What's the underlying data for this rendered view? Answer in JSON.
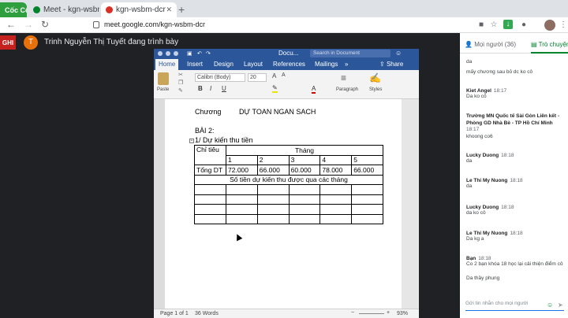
{
  "browser": {
    "tabs": [
      {
        "label": "Cốc Cốc"
      },
      {
        "label": "Meet - kgn-wsbm-dcr"
      },
      {
        "label": "kgn-wsbm-dcr"
      }
    ],
    "new_tab": "+",
    "url": "meet.google.com/kgn-wsbm-dcr",
    "nav": {
      "back": "←",
      "forward": "→",
      "reload": "↻"
    }
  },
  "meet": {
    "recording_label": "GHI",
    "presenter_initial": "T",
    "presenter_text": "Trinh Nguyễn Thị Tuyết đang trình bày"
  },
  "word": {
    "title": "Docu...",
    "search_placeholder": "Search in Document",
    "ribbon_tabs": [
      "Home",
      "Insert",
      "Design",
      "Layout",
      "References",
      "Mailings",
      "»"
    ],
    "share_label": "Share",
    "paste_label": "Paste",
    "font_name": "Calibri (Body)",
    "font_size": "20",
    "paragraph_label": "Paragraph",
    "styles_label": "Styles",
    "format_buttons": [
      "B",
      "I",
      "U",
      "A"
    ],
    "status": {
      "page": "Page 1 of 1",
      "words": "36 Words",
      "zoom": "93%",
      "zoom_minus": "−",
      "zoom_plus": "+"
    }
  },
  "document": {
    "heading_left": "Chương",
    "heading_right": "DỰ TOAN NGAN SACH",
    "exercise": "BÀI 2:",
    "section": "1/ Dự kiến thu tiền",
    "table": {
      "header_left": "Chỉ tiêu",
      "header_month": "Tháng",
      "months": [
        "1",
        "2",
        "3",
        "4",
        "5"
      ],
      "row_label": "Tổng DT",
      "row_values": [
        "72.000",
        "66.000",
        "60.000",
        "78.000",
        "66.000"
      ],
      "subtitle": "Số tiền dự kiến thu được qua các tháng"
    }
  },
  "chat": {
    "tab_people": "Mọi người (36)",
    "tab_chat": "Trò chuyện",
    "messages": [
      {
        "name": "",
        "time": "",
        "text": "da"
      },
      {
        "name": "",
        "time": "",
        "text": "mấy chương sau bỏ dc ko cô"
      },
      {
        "name": "Kiet Angel",
        "time": "18:17",
        "text": "Da ko cô"
      },
      {
        "name": "Trường MN Quốc tế Sài Gòn Liên kết - Phòng GD Nhà Bè - TP Hồ Chí Minh",
        "time": "18:17",
        "text": "khoong co6"
      },
      {
        "name": "Lucky Duong",
        "time": "18:18",
        "text": "da"
      },
      {
        "name": "Le Thi My Nuong",
        "time": "18:18",
        "text": "da"
      },
      {
        "name": "Lucky Duong",
        "time": "18:18",
        "text": "da ko cô"
      },
      {
        "name": "Le Thi My Nuong",
        "time": "18:18",
        "text": "Da kg a"
      },
      {
        "name": "Bạn",
        "time": "18:18",
        "text": "Co 2 bạn khóa 18 học lại cải thiện điểm cô"
      },
      {
        "name": "",
        "time": "",
        "text": "Da thầy phung"
      }
    ],
    "input_placeholder": "Gửi tin nhắn cho mọi người"
  },
  "colors": {
    "word_blue": "#2b579a",
    "meet_dark": "#202124",
    "chat_accent": "#1a73e8"
  }
}
